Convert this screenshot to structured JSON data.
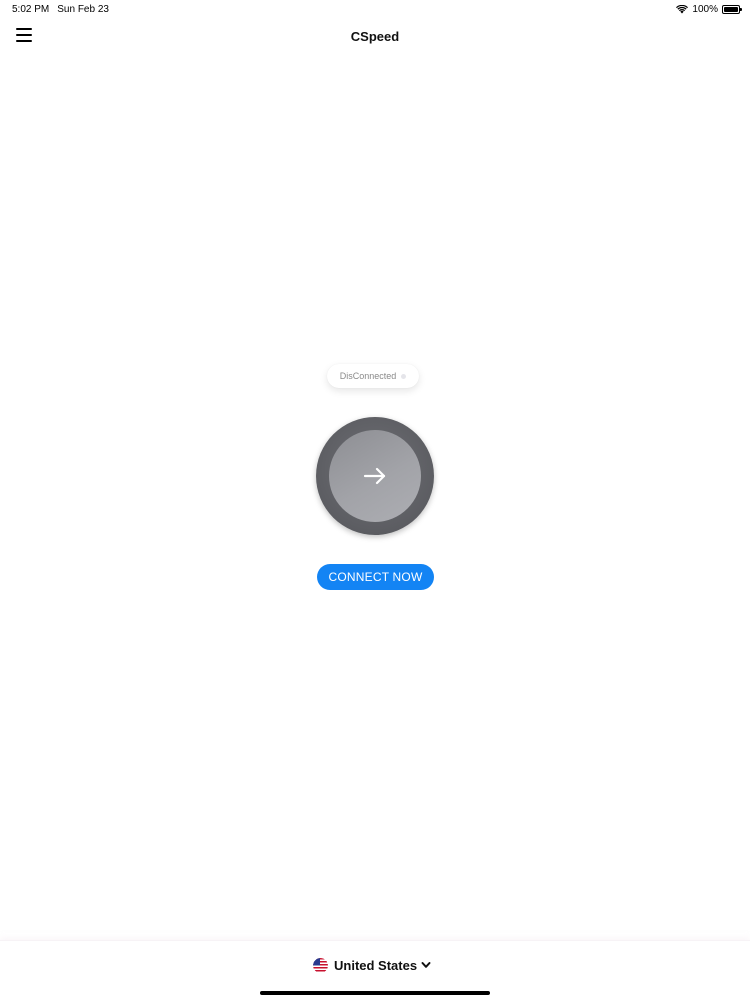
{
  "status_bar": {
    "time": "5:02 PM",
    "date": "Sun Feb 23",
    "battery": "100%",
    "battery_level": 1.0,
    "icons": [
      "wifi-icon",
      "battery-icon"
    ]
  },
  "nav": {
    "title": "CSpeed",
    "menu_icon": "hamburger-menu-icon"
  },
  "connection": {
    "status": "DisConnected",
    "button_icon": "arrow-right-icon",
    "action_label": "CONNECT NOW"
  },
  "location": {
    "country": "United States",
    "flag_icon": "us-flag-icon",
    "chevron_icon": "chevron-down-icon"
  },
  "colors": {
    "accent": "#1384f4",
    "circle_outer": "#5c5d62",
    "circle_inner": "#a2a3a8",
    "status_text": "#8a8a8a"
  }
}
